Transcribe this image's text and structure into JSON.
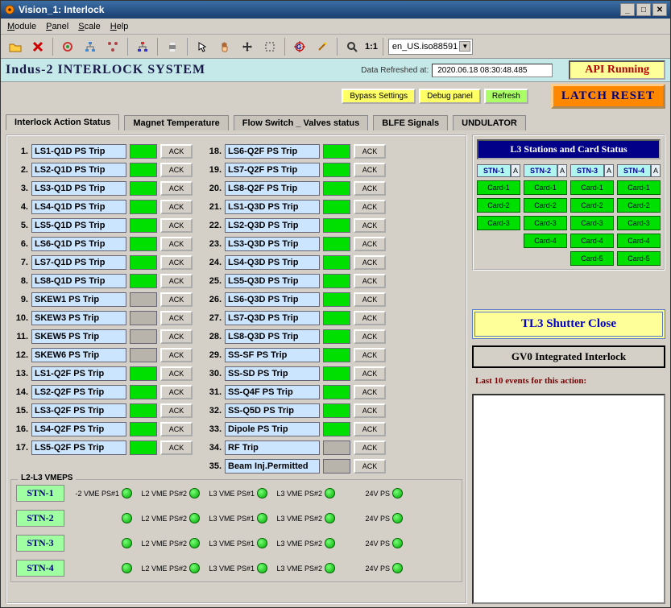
{
  "window": {
    "title": "Vision_1: Interlock"
  },
  "menu": {
    "items": [
      "Module",
      "Panel",
      "Scale",
      "Help"
    ]
  },
  "toolbar": {
    "encoding": "en_US.iso88591",
    "ratio": "1:1"
  },
  "header": {
    "title": "Indus-2 INTERLOCK SYSTEM",
    "refreshed_label": "Data Refreshed at:",
    "refreshed_value": "2020.06.18 08:30:48.485",
    "api_status": "API Running",
    "bypass": "Bypass Settings",
    "debug": "Debug panel",
    "refresh": "Refresh",
    "latch_reset": "LATCH RESET"
  },
  "tabs": [
    "Interlock Action Status",
    "Magnet Temperature",
    "Flow Switch _ Valves status",
    "BLFE Signals",
    "UNDULATOR"
  ],
  "items_left": [
    {
      "n": "1.",
      "name": "LS1-Q1D PS Trip",
      "s": "green"
    },
    {
      "n": "2.",
      "name": "LS2-Q1D PS Trip",
      "s": "green"
    },
    {
      "n": "3.",
      "name": "LS3-Q1D PS Trip",
      "s": "green"
    },
    {
      "n": "4.",
      "name": "LS4-Q1D PS Trip",
      "s": "green"
    },
    {
      "n": "5.",
      "name": "LS5-Q1D PS Trip",
      "s": "green"
    },
    {
      "n": "6.",
      "name": "LS6-Q1D PS Trip",
      "s": "green"
    },
    {
      "n": "7.",
      "name": "LS7-Q1D PS Trip",
      "s": "green"
    },
    {
      "n": "8.",
      "name": "LS8-Q1D PS Trip",
      "s": "green"
    },
    {
      "n": "9.",
      "name": "SKEW1 PS Trip",
      "s": "grey"
    },
    {
      "n": "10.",
      "name": "SKEW3 PS Trip",
      "s": "grey"
    },
    {
      "n": "11.",
      "name": "SKEW5 PS Trip",
      "s": "grey"
    },
    {
      "n": "12.",
      "name": "SKEW6 PS Trip",
      "s": "grey"
    },
    {
      "n": "13.",
      "name": "LS1-Q2F PS Trip",
      "s": "green"
    },
    {
      "n": "14.",
      "name": "LS2-Q2F PS Trip",
      "s": "green"
    },
    {
      "n": "15.",
      "name": "LS3-Q2F PS Trip",
      "s": "green"
    },
    {
      "n": "16.",
      "name": "LS4-Q2F PS Trip",
      "s": "green"
    },
    {
      "n": "17.",
      "name": "LS5-Q2F PS Trip",
      "s": "green"
    }
  ],
  "items_right": [
    {
      "n": "18.",
      "name": "LS6-Q2F PS Trip",
      "s": "green"
    },
    {
      "n": "19.",
      "name": "LS7-Q2F PS Trip",
      "s": "green"
    },
    {
      "n": "20.",
      "name": "LS8-Q2F PS Trip",
      "s": "green"
    },
    {
      "n": "21.",
      "name": "LS1-Q3D PS Trip",
      "s": "green"
    },
    {
      "n": "22.",
      "name": "LS2-Q3D PS Trip",
      "s": "green"
    },
    {
      "n": "23.",
      "name": "LS3-Q3D PS Trip",
      "s": "green"
    },
    {
      "n": "24.",
      "name": "LS4-Q3D PS Trip",
      "s": "green"
    },
    {
      "n": "25.",
      "name": "LS5-Q3D PS Trip",
      "s": "green"
    },
    {
      "n": "26.",
      "name": "LS6-Q3D PS Trip",
      "s": "green"
    },
    {
      "n": "27.",
      "name": "LS7-Q3D PS Trip",
      "s": "green"
    },
    {
      "n": "28.",
      "name": "LS8-Q3D PS Trip",
      "s": "green"
    },
    {
      "n": "29.",
      "name": "SS-SF PS Trip",
      "s": "green"
    },
    {
      "n": "30.",
      "name": "SS-SD PS Trip",
      "s": "green"
    },
    {
      "n": "31.",
      "name": "SS-Q4F PS Trip",
      "s": "green"
    },
    {
      "n": "32.",
      "name": "SS-Q5D PS Trip",
      "s": "green"
    },
    {
      "n": "33.",
      "name": "Dipole PS Trip",
      "s": "green"
    },
    {
      "n": "34.",
      "name": "RF Trip",
      "s": "grey"
    },
    {
      "n": "35.",
      "name": "Beam Inj.Permitted",
      "s": "grey"
    }
  ],
  "ack_label": "ACK",
  "vmeps": {
    "title": "L2-L3 VMEPS",
    "stations": [
      "STN-1",
      "STN-2",
      "STN-3",
      "STN-4"
    ],
    "cols_first": [
      "-2 VME PS#1",
      "L2 VME PS#2",
      "L3 VME PS#1",
      "L3 VME PS#2",
      "24V PS"
    ],
    "cols": [
      "",
      "L2 VME PS#2",
      "L3 VME PS#1",
      "L3 VME PS#2",
      "24V PS"
    ]
  },
  "stations": {
    "title": "L3 Stations and Card Status",
    "heads": [
      "STN-1",
      "STN-2",
      "STN-3",
      "STN-4"
    ],
    "a": "A",
    "cols": [
      [
        "Card-1",
        "Card-2",
        "Card-3"
      ],
      [
        "Card-1",
        "Card-2",
        "Card-3",
        "Card-4"
      ],
      [
        "Card-1",
        "Card-2",
        "Card-3",
        "Card-4",
        "Card-5"
      ],
      [
        "Card-1",
        "Card-2",
        "Card-3",
        "Card-4",
        "Card-5"
      ]
    ]
  },
  "tl3": "TL3 Shutter Close",
  "gv0": "GV0 Integrated Interlock",
  "events_label": "Last 10 events for this action:"
}
